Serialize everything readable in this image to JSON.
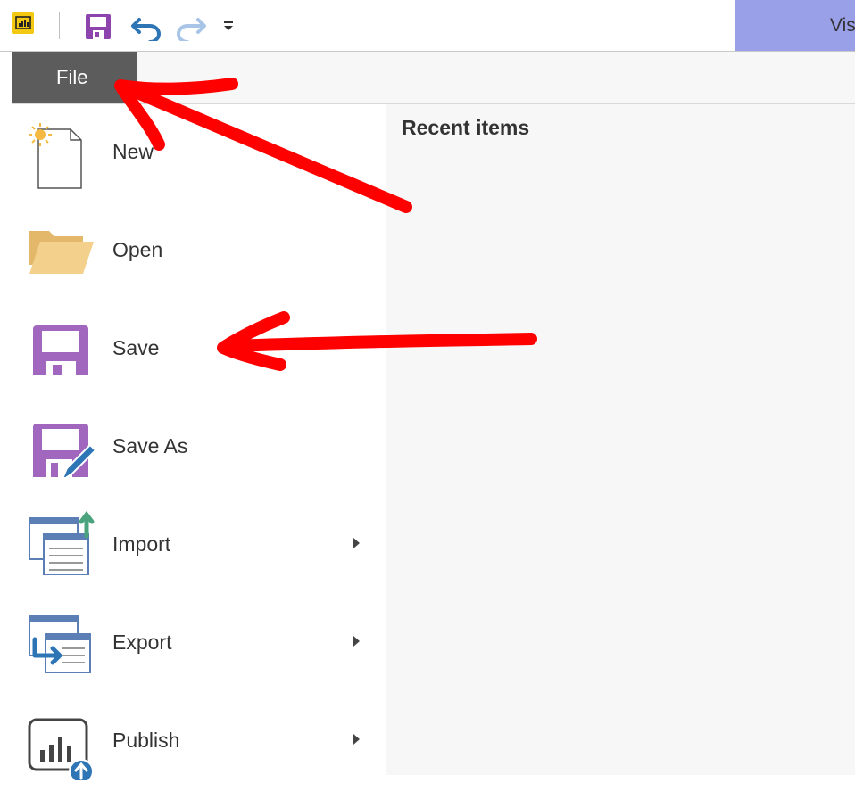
{
  "toolbar": {
    "logo_icon": "power-bi-icon",
    "save_icon": "save-icon",
    "undo_icon": "undo-icon",
    "redo_icon": "redo-icon",
    "customize_icon": "customize-qat-icon",
    "ribbon_tab_fragment": "Vis"
  },
  "file_tab": {
    "label": "File"
  },
  "menu": {
    "items": [
      {
        "label": "New",
        "icon": "new-file-icon"
      },
      {
        "label": "Open",
        "icon": "folder-icon"
      },
      {
        "label": "Save",
        "icon": "save-icon"
      },
      {
        "label": "Save As",
        "icon": "save-as-icon"
      },
      {
        "label": "Import",
        "icon": "import-icon",
        "has_submenu": true
      },
      {
        "label": "Export",
        "icon": "export-icon",
        "has_submenu": true
      },
      {
        "label": "Publish",
        "icon": "publish-icon",
        "has_submenu": true
      }
    ]
  },
  "recent": {
    "header": "Recent items"
  },
  "colors": {
    "file_tab_bg": "#5c5c5c",
    "save_purple": "#9b59b6",
    "annotation_red": "#ff0000",
    "ribbon_tab_bg": "#9aa0e8",
    "pbi_yellow": "#f2c811"
  }
}
